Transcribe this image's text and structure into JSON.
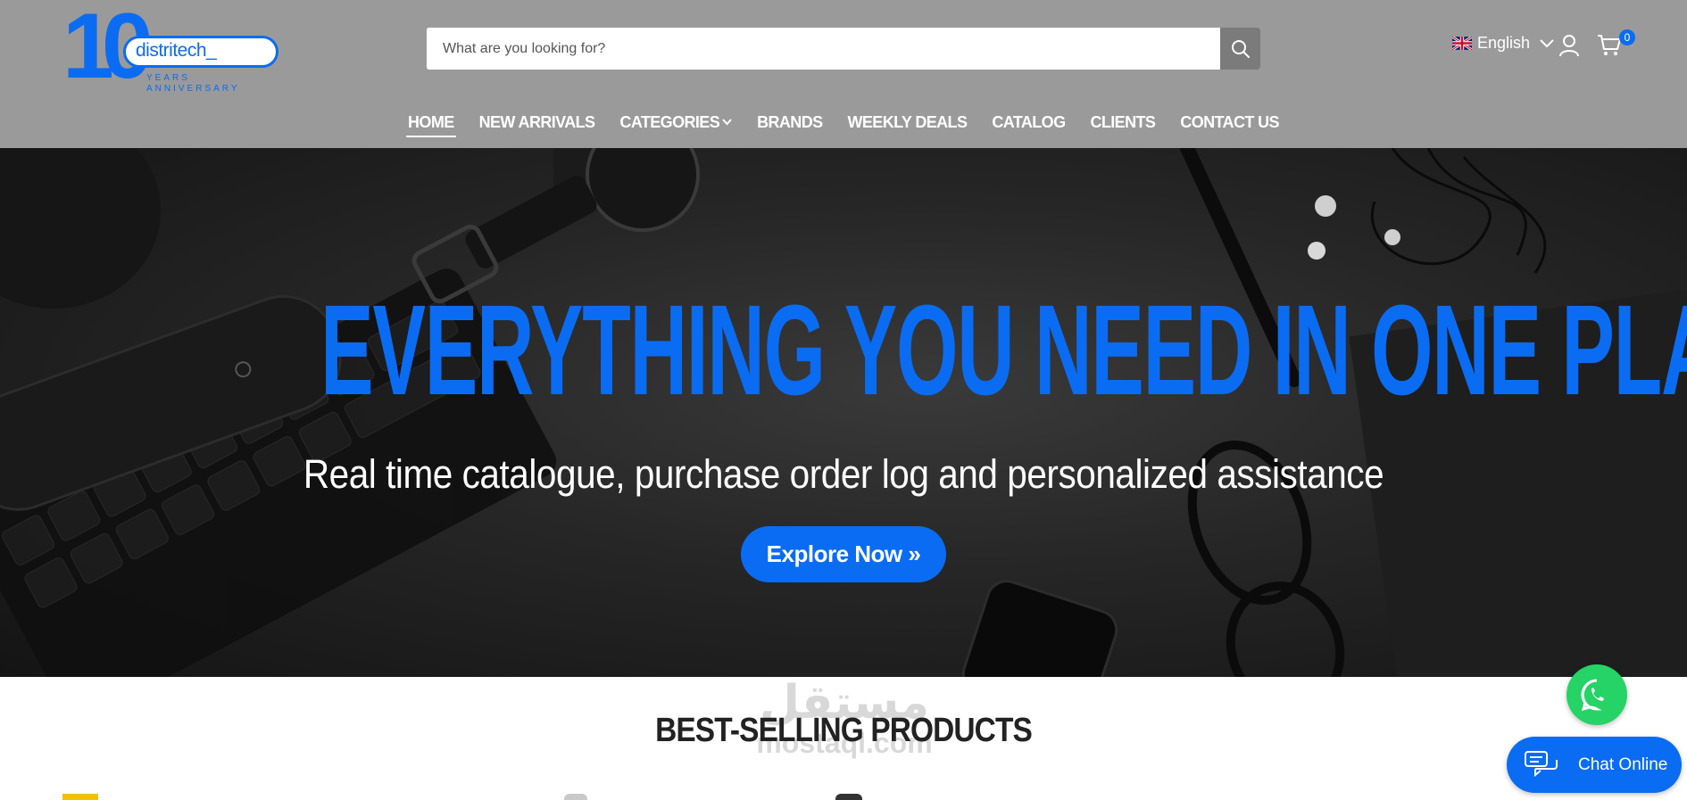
{
  "brand": {
    "logo_number": "10",
    "logo_name": "distritech_",
    "logo_line1": "YEARS",
    "logo_line2": "ANNIVERSARY"
  },
  "search": {
    "placeholder": "What are you looking for?",
    "button_icon": "search-icon"
  },
  "header": {
    "language": "English",
    "language_icon": "uk-flag-icon",
    "cart_count": "0"
  },
  "nav": {
    "items": [
      {
        "label": "HOME",
        "active": true
      },
      {
        "label": "NEW ARRIVALS"
      },
      {
        "label": "CATEGORIES",
        "has_dropdown": true
      },
      {
        "label": "BRANDS"
      },
      {
        "label": "WEEKLY DEALS"
      },
      {
        "label": "CATALOG"
      },
      {
        "label": "CLIENTS"
      },
      {
        "label": "CONTACT US"
      }
    ]
  },
  "hero": {
    "title": "EVERYTHING YOU NEED IN ONE PLACE",
    "subtitle": "Real time catalogue, purchase order log and personalized assistance",
    "button": "Explore Now »"
  },
  "section": {
    "title": "BEST-SELLING PRODUCTS"
  },
  "watermark": {
    "arabic": "مستقل",
    "latin": "mostaql.com"
  },
  "chat": {
    "label": "Chat Online"
  },
  "colors": {
    "accent": "#0a6cf2",
    "header_bg": "#9a9a9a",
    "whatsapp": "#25d366"
  }
}
